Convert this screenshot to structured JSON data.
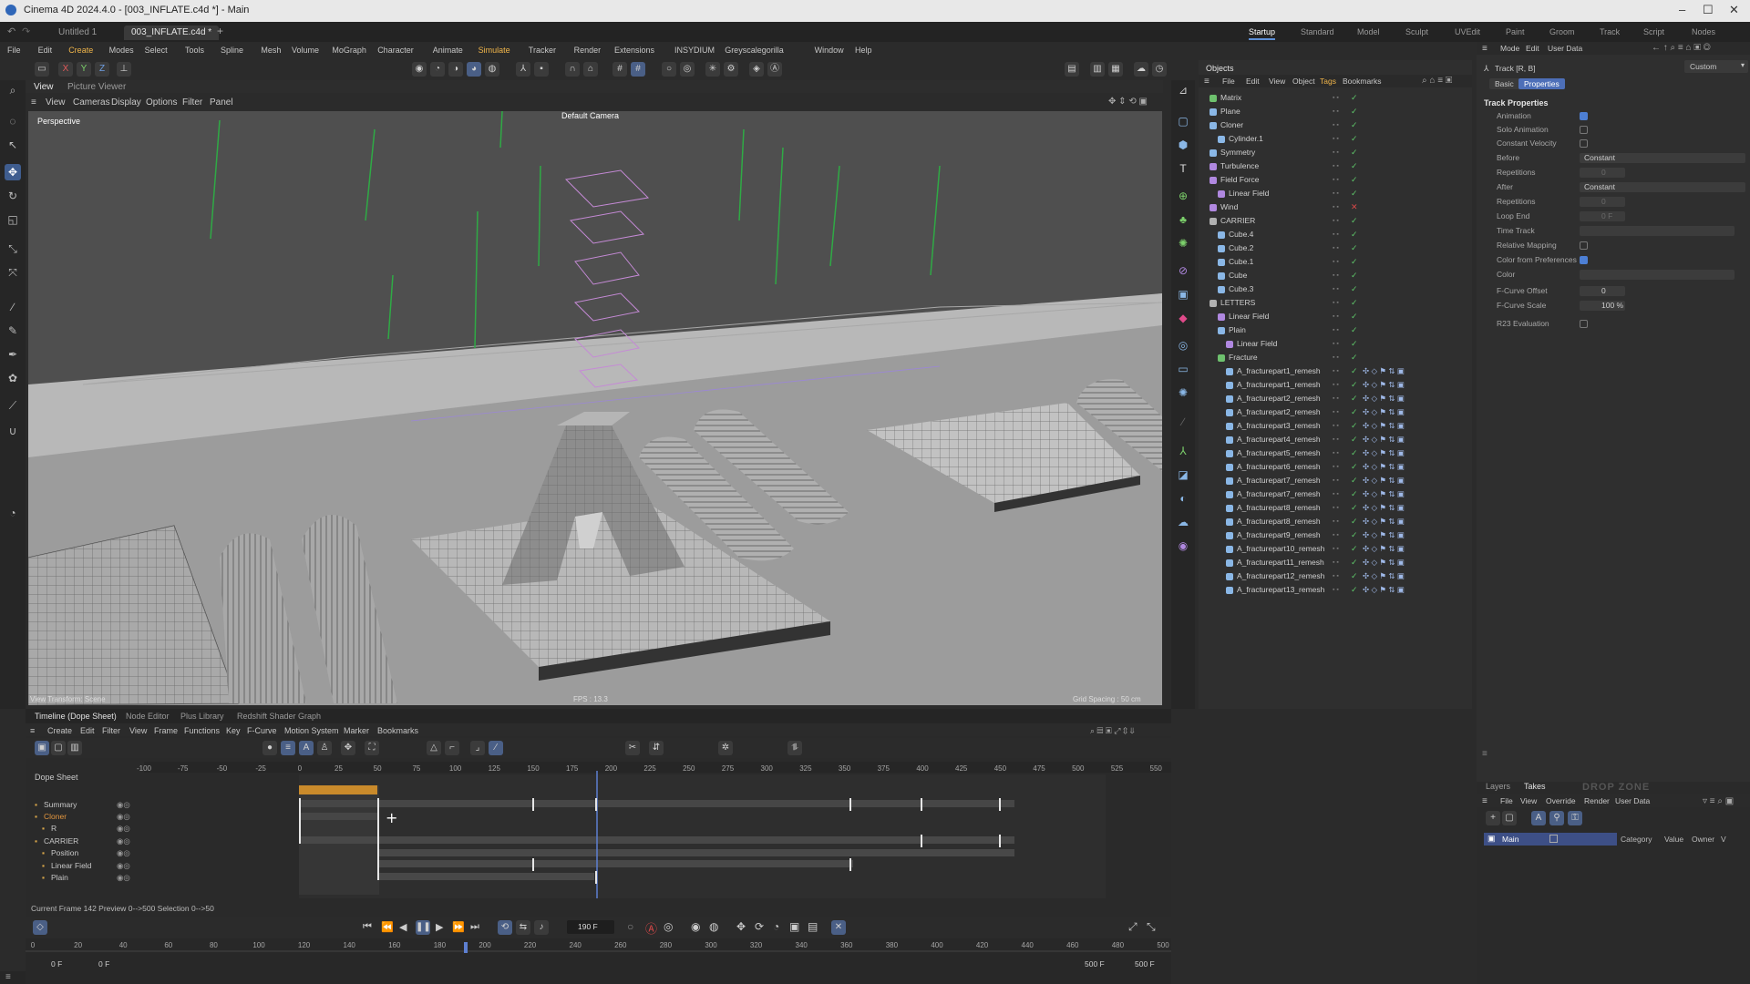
{
  "window": {
    "title": "Cinema 4D 2024.4.0 - [003_INFLATE.c4d *] - Main"
  },
  "doc_tabs": [
    "Untitled 1",
    "003_INFLATE.c4d *"
  ],
  "layout_tabs": [
    "Startup",
    "Standard",
    "Model",
    "Sculpt",
    "UVEdit",
    "Paint",
    "Groom",
    "Track",
    "Script",
    "Nodes"
  ],
  "active_layout": "Startup",
  "menu": [
    "File",
    "Edit",
    "Create",
    "Modes",
    "Select",
    "Tools",
    "Spline",
    "Mesh",
    "Volume",
    "MoGraph",
    "Character",
    "Animate",
    "Simulate",
    "Tracker",
    "Render",
    "Extensions",
    "INSYDIUM",
    "Greyscalegorilla",
    "Window",
    "Help"
  ],
  "highlighted_menus": [
    "Create",
    "Simulate"
  ],
  "viewport": {
    "tabs": [
      "View",
      "Picture Viewer"
    ],
    "menu": [
      "View",
      "Cameras",
      "Display",
      "Options",
      "Filter",
      "Panel"
    ],
    "label": "Perspective",
    "camera": "Default Camera",
    "fps": "FPS : 13.3",
    "grid": "Grid Spacing : 50 cm",
    "transform": "View Transform: Scene"
  },
  "objects_panel": {
    "title": "Objects",
    "menu": [
      "File",
      "Edit",
      "View",
      "Object",
      "Tags",
      "Bookmarks"
    ],
    "rows": [
      {
        "name": "Matrix",
        "indent": 0,
        "color": "#6ec16e"
      },
      {
        "name": "Plane",
        "indent": 0,
        "color": "#8ab7e6"
      },
      {
        "name": "Cloner",
        "indent": 0,
        "color": "#8ab7e6"
      },
      {
        "name": "Cylinder.1",
        "indent": 1,
        "color": "#8ab7e6"
      },
      {
        "name": "Symmetry",
        "indent": 0,
        "color": "#8ab7e6"
      },
      {
        "name": "Turbulence",
        "indent": 0,
        "color": "#b088e0"
      },
      {
        "name": "Field Force",
        "indent": 0,
        "color": "#b088e0"
      },
      {
        "name": "Linear Field",
        "indent": 1,
        "color": "#b088e0"
      },
      {
        "name": "Wind",
        "indent": 0,
        "color": "#b088e0"
      },
      {
        "name": "CARRIER",
        "indent": 0,
        "color": "#b0b0b0"
      },
      {
        "name": "Cube.4",
        "indent": 1,
        "color": "#8ab7e6"
      },
      {
        "name": "Cube.2",
        "indent": 1,
        "color": "#8ab7e6"
      },
      {
        "name": "Cube.1",
        "indent": 1,
        "color": "#8ab7e6"
      },
      {
        "name": "Cube",
        "indent": 1,
        "color": "#8ab7e6"
      },
      {
        "name": "Cube.3",
        "indent": 1,
        "color": "#8ab7e6"
      },
      {
        "name": "LETTERS",
        "indent": 0,
        "color": "#b0b0b0"
      },
      {
        "name": "Linear Field",
        "indent": 1,
        "color": "#b088e0"
      },
      {
        "name": "Plain",
        "indent": 1,
        "color": "#8ab7e6"
      },
      {
        "name": "Linear Field",
        "indent": 2,
        "color": "#b088e0"
      },
      {
        "name": "Fracture",
        "indent": 1,
        "color": "#6ec16e"
      },
      {
        "name": "A_fracturepart1_remesh",
        "indent": 2,
        "color": "#8ab7e6"
      },
      {
        "name": "A_fracturepart1_remesh",
        "indent": 2,
        "color": "#8ab7e6"
      },
      {
        "name": "A_fracturepart2_remesh",
        "indent": 2,
        "color": "#8ab7e6"
      },
      {
        "name": "A_fracturepart2_remesh",
        "indent": 2,
        "color": "#8ab7e6"
      },
      {
        "name": "A_fracturepart3_remesh",
        "indent": 2,
        "color": "#8ab7e6"
      },
      {
        "name": "A_fracturepart4_remesh",
        "indent": 2,
        "color": "#8ab7e6"
      },
      {
        "name": "A_fracturepart5_remesh",
        "indent": 2,
        "color": "#8ab7e6"
      },
      {
        "name": "A_fracturepart6_remesh",
        "indent": 2,
        "color": "#8ab7e6"
      },
      {
        "name": "A_fracturepart7_remesh",
        "indent": 2,
        "color": "#8ab7e6"
      },
      {
        "name": "A_fracturepart7_remesh",
        "indent": 2,
        "color": "#8ab7e6"
      },
      {
        "name": "A_fracturepart8_remesh",
        "indent": 2,
        "color": "#8ab7e6"
      },
      {
        "name": "A_fracturepart8_remesh",
        "indent": 2,
        "color": "#8ab7e6"
      },
      {
        "name": "A_fracturepart9_remesh",
        "indent": 2,
        "color": "#8ab7e6"
      },
      {
        "name": "A_fracturepart10_remesh",
        "indent": 2,
        "color": "#8ab7e6"
      },
      {
        "name": "A_fracturepart11_remesh",
        "indent": 2,
        "color": "#8ab7e6"
      },
      {
        "name": "A_fracturepart12_remesh",
        "indent": 2,
        "color": "#8ab7e6"
      },
      {
        "name": "A_fracturepart13_remesh",
        "indent": 2,
        "color": "#8ab7e6"
      }
    ]
  },
  "attributes": {
    "menu": [
      "Mode",
      "Edit",
      "User Data"
    ],
    "track": "Track [R, B]",
    "preset": "Custom",
    "tabs": [
      "Basic",
      "Properties"
    ],
    "active_tab": "Properties",
    "section": "Track Properties",
    "fields": [
      {
        "label": "Animation",
        "type": "check",
        "on": true
      },
      {
        "label": "Solo Animation",
        "type": "check",
        "on": false
      },
      {
        "label": "Constant Velocity",
        "type": "check",
        "on": false
      },
      {
        "label": "Before",
        "type": "select",
        "value": "Constant"
      },
      {
        "label": "Repetitions",
        "type": "num",
        "value": "0"
      },
      {
        "label": "After",
        "type": "select",
        "value": "Constant"
      },
      {
        "label": "Repetitions",
        "type": "num",
        "value": "0"
      },
      {
        "label": "Loop End",
        "type": "num",
        "value": "0 F"
      },
      {
        "label": "Time Track",
        "type": "field",
        "value": ""
      },
      {
        "label": "Relative Mapping",
        "type": "check",
        "on": false
      },
      {
        "label": "Color from Preferences",
        "type": "check",
        "on": true
      },
      {
        "label": "Color",
        "type": "field",
        "value": ""
      },
      {
        "label": "F-Curve Offset",
        "type": "num",
        "value": "0"
      },
      {
        "label": "F-Curve Scale",
        "type": "num",
        "value": "100 %"
      },
      {
        "label": "R23 Evaluation",
        "type": "check",
        "on": false
      }
    ]
  },
  "timeline": {
    "tabs": [
      "Timeline (Dope Sheet)",
      "Node Editor",
      "Plus Library",
      "Redshift Shader Graph"
    ],
    "menu": [
      "View",
      "Create",
      "Edit",
      "Filter",
      "View",
      "Frame",
      "Functions",
      "Key",
      "F-Curve",
      "Motion System",
      "Marker",
      "Bookmarks"
    ],
    "header": "Dope Sheet",
    "ticks": [
      "-100",
      "-75",
      "-50",
      "-25",
      "0",
      "25",
      "50",
      "75",
      "100",
      "125",
      "150",
      "175",
      "200",
      "225",
      "250",
      "275",
      "300",
      "325",
      "350",
      "375",
      "400",
      "425",
      "450",
      "475",
      "500",
      "525",
      "550"
    ],
    "tracks": [
      "Summary",
      "Cloner",
      "R",
      "CARRIER",
      "Position",
      "Linear Field",
      "Plain"
    ],
    "status": "Current Frame  142  Preview  0-->500  Selection 0-->50",
    "frame_field": "190 F",
    "range_ticks": [
      "0",
      "20",
      "40",
      "60",
      "80",
      "100",
      "120",
      "140",
      "160",
      "180",
      "200",
      "220",
      "240",
      "260",
      "280",
      "300",
      "320",
      "340",
      "360",
      "380",
      "400",
      "420",
      "440",
      "460",
      "480",
      "500"
    ],
    "start": "0 F",
    "start2": "0 F",
    "end": "500 F",
    "end2": "500 F"
  },
  "layers": {
    "tabs": [
      "Layers",
      "Takes"
    ],
    "active": "Takes",
    "menu": [
      "File",
      "View",
      "Override",
      "Render",
      "User Data"
    ],
    "take": "Main",
    "columns": [
      "Category",
      "Value",
      "Owner",
      "V"
    ],
    "logo": "DROP ZONE"
  }
}
